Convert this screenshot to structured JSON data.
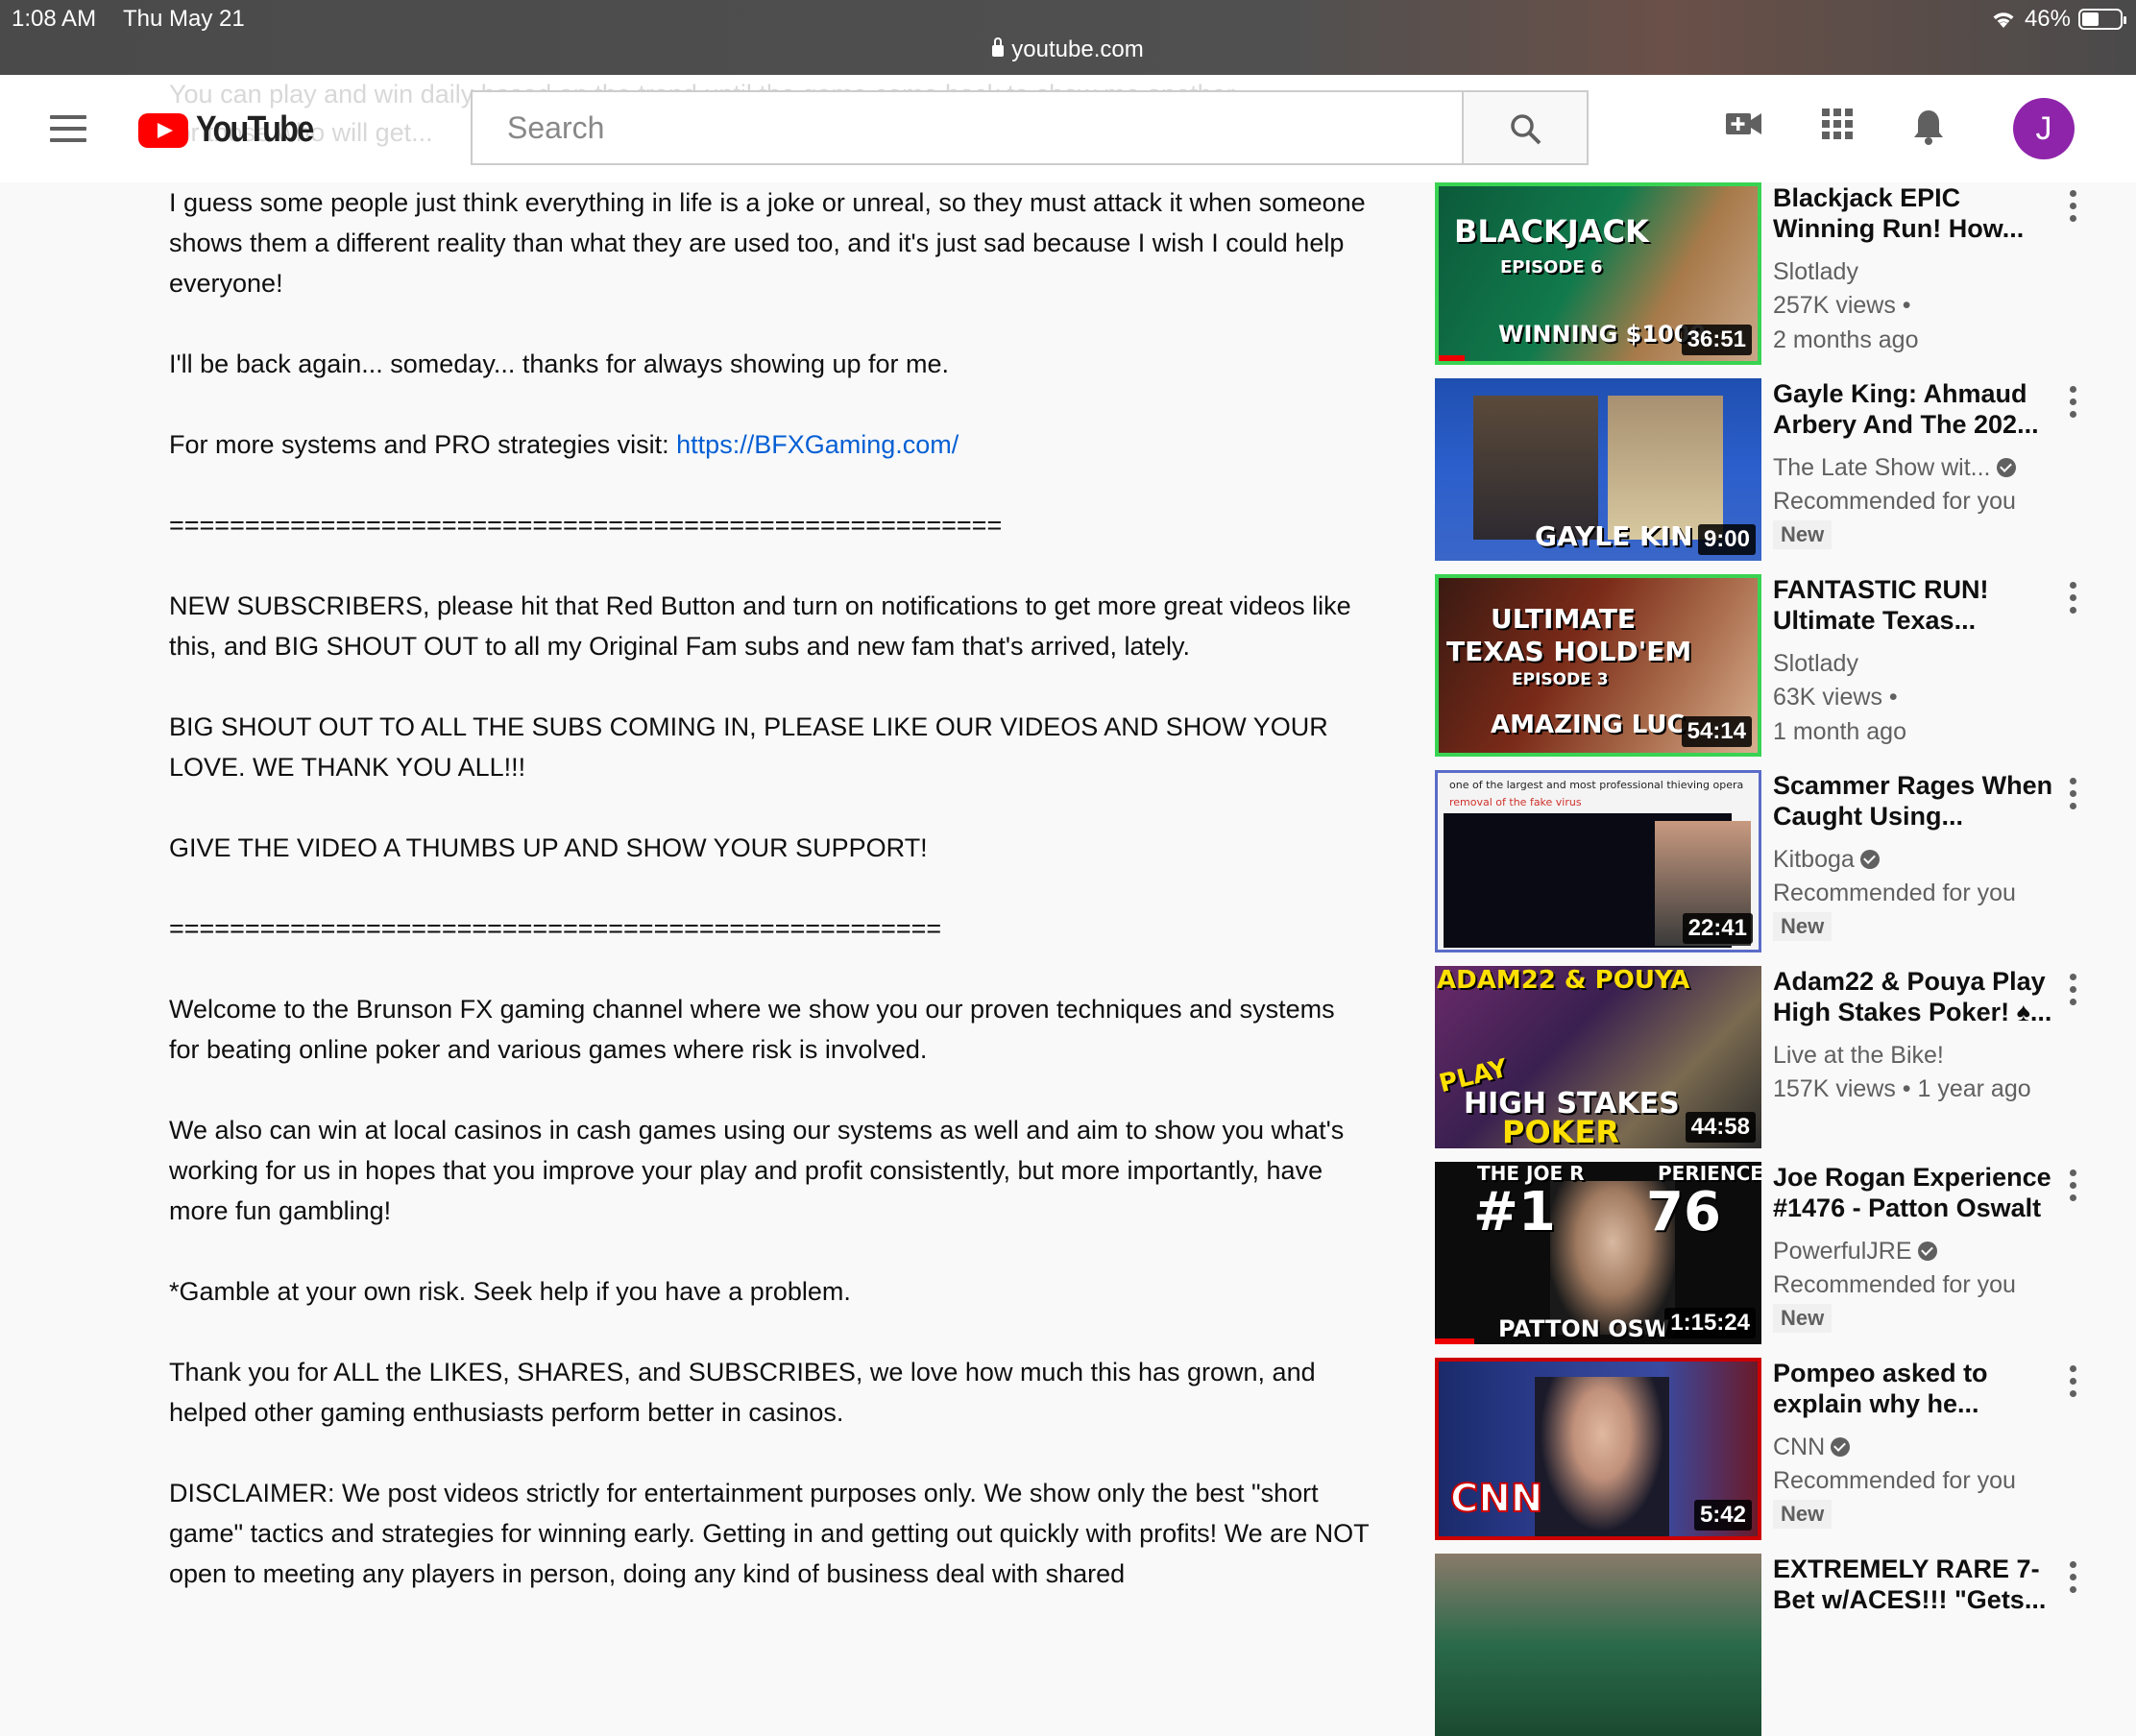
{
  "status_bar": {
    "time": "1:08 AM",
    "date": "Thu May 21",
    "battery": "46%",
    "battery_level": 0.46,
    "url": "youtube.com"
  },
  "header": {
    "logo_text": "YouTube",
    "search_placeholder": "Search",
    "avatar_letter": "J",
    "ghost_line_1": "You can play and win daily based on the trend until the game come back to show me another",
    "ghost_line_2": "for those who will get..."
  },
  "description": {
    "p1": "I guess some people just think everything in life is a joke or unreal, so they must attack it when someone shows them a different reality than what they are used too, and it's just sad because I wish I could help everyone!",
    "p2": "I'll be back again... someday... thanks for always showing up for me.",
    "p3_prefix": "For more systems and PRO strategies visit: ",
    "p3_link": "https://BFXGaming.com/",
    "divider1": "=======================================================",
    "p4": "NEW SUBSCRIBERS, please hit that Red Button and turn on notifications to get more great videos like this, and BIG SHOUT OUT to all my Original Fam subs and new fam that's arrived, lately.",
    "p5": "BIG SHOUT OUT TO ALL THE SUBS COMING IN, PLEASE LIKE OUR VIDEOS AND SHOW YOUR LOVE. WE THANK YOU ALL!!!",
    "p6": "GIVE THE VIDEO A THUMBS UP AND SHOW YOUR SUPPORT!",
    "divider2": "===================================================",
    "p7": "Welcome to the Brunson FX gaming channel where we show you our proven techniques and systems for beating online poker and various games where risk is involved.",
    "p8": "We also can win at local casinos in cash games using our systems as well and aim to show you what's working for us in hopes that you improve your play and profit consistently, but more importantly, have more fun gambling!",
    "p9": "*Gamble at your own risk. Seek help if you have a problem.",
    "p10": "Thank you for ALL the LIKES, SHARES, and SUBSCRIBES, we love how much this has grown, and helped other gaming enthusiasts perform better in casinos.",
    "p11": "DISCLAIMER: We post videos strictly for entertainment purposes only. We show only the best \"short game\" tactics and strategies for winning early. Getting in and getting out quickly with profits! We are NOT open to meeting any players in person, doing any kind of business deal with shared"
  },
  "sidebar": {
    "videos": [
      {
        "title": "Blackjack EPIC Winning Run! How...",
        "channel": "Slotlady",
        "views": "257K views •",
        "age": "2 months ago",
        "duration": "36:51",
        "thumb_lines": [
          "BLACKJACK",
          "EPISODE 6",
          "WINNING $1000"
        ],
        "progress": 0.08
      },
      {
        "title": "Gayle King: Ahmaud Arbery And The 202...",
        "channel": "The Late Show wit...",
        "verified": true,
        "note": "Recommended for you",
        "badge": "New",
        "duration": "9:00",
        "thumb_lines": [
          "GAYLE KIN"
        ]
      },
      {
        "title": "FANTASTIC RUN! Ultimate Texas...",
        "channel": "Slotlady",
        "views": "63K views •",
        "age": "1 month ago",
        "duration": "54:14",
        "thumb_lines": [
          "ULTIMATE",
          "TEXAS HOLD'EM",
          "EPISODE 3",
          "AMAZING LUC"
        ]
      },
      {
        "title": "Scammer Rages When Caught Using...",
        "channel": "Kitboga",
        "verified": true,
        "note": "Recommended for you",
        "badge": "New",
        "duration": "22:41",
        "thumb_lines": [
          "one of the largest and most professional thieving opera",
          "removal of the fake virus"
        ]
      },
      {
        "title": "Adam22 & Pouya Play High Stakes Poker! ♠...",
        "channel": "Live at the Bike!",
        "views": "157K views • 1 year ago",
        "duration": "44:58",
        "thumb_lines": [
          "ADAM22 & POUYA",
          "PLAY",
          "HIGH STAKES",
          "POKER"
        ]
      },
      {
        "title": "Joe Rogan Experience #1476 - Patton Oswalt",
        "channel": "PowerfulJRE",
        "verified": true,
        "note": "Recommended for you",
        "badge": "New",
        "duration": "1:15:24",
        "thumb_lines": [
          "THE JOE R",
          "PERIENCE",
          "#1",
          "76",
          "PATTON OSW"
        ],
        "progress": 0.12
      },
      {
        "title": "Pompeo asked to explain why he...",
        "channel": "CNN",
        "verified": true,
        "note": "Recommended for you",
        "badge": "New",
        "duration": "5:42",
        "thumb_lines": [
          "CNN"
        ]
      },
      {
        "title": "EXTREMELY RARE 7-Bet w/ACES!!! \"Gets..."
      }
    ]
  },
  "colors": {
    "youtube_red": "#ff0000",
    "link": "#065fd4",
    "avatar": "#8e24aa"
  },
  "icons": [
    "menu-icon",
    "search-icon",
    "create-video-icon",
    "apps-icon",
    "bell-icon",
    "more-vert-icon",
    "verified-icon",
    "lock-icon",
    "wifi-icon",
    "battery-icon"
  ]
}
